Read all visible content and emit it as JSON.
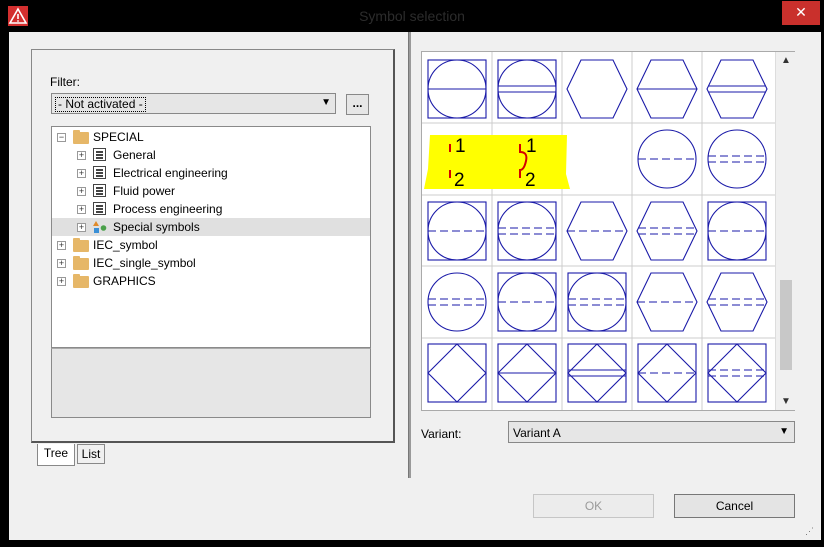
{
  "window": {
    "title": "Symbol selection",
    "close": "✕"
  },
  "filter": {
    "label": "Filter:",
    "value": "- Not activated -",
    "dots": "..."
  },
  "tree": {
    "root": "SPECIAL",
    "children": [
      "General",
      "Electrical engineering",
      "Fluid power",
      "Process engineering",
      "Special symbols"
    ],
    "others": [
      "IEC_symbol",
      "IEC_single_symbol",
      "GRAPHICS"
    ]
  },
  "tabs": [
    "Tree",
    "List"
  ],
  "grid": {
    "highlighted_labels": [
      "1",
      "2",
      "1",
      "2"
    ]
  },
  "variant": {
    "label": "Variant:",
    "value": "Variant A"
  },
  "buttons": {
    "ok": "OK",
    "cancel": "Cancel"
  },
  "colors": {
    "symbol_stroke": "#1a1aa8",
    "highlight": "#ffff00",
    "close": "#c9302c"
  }
}
